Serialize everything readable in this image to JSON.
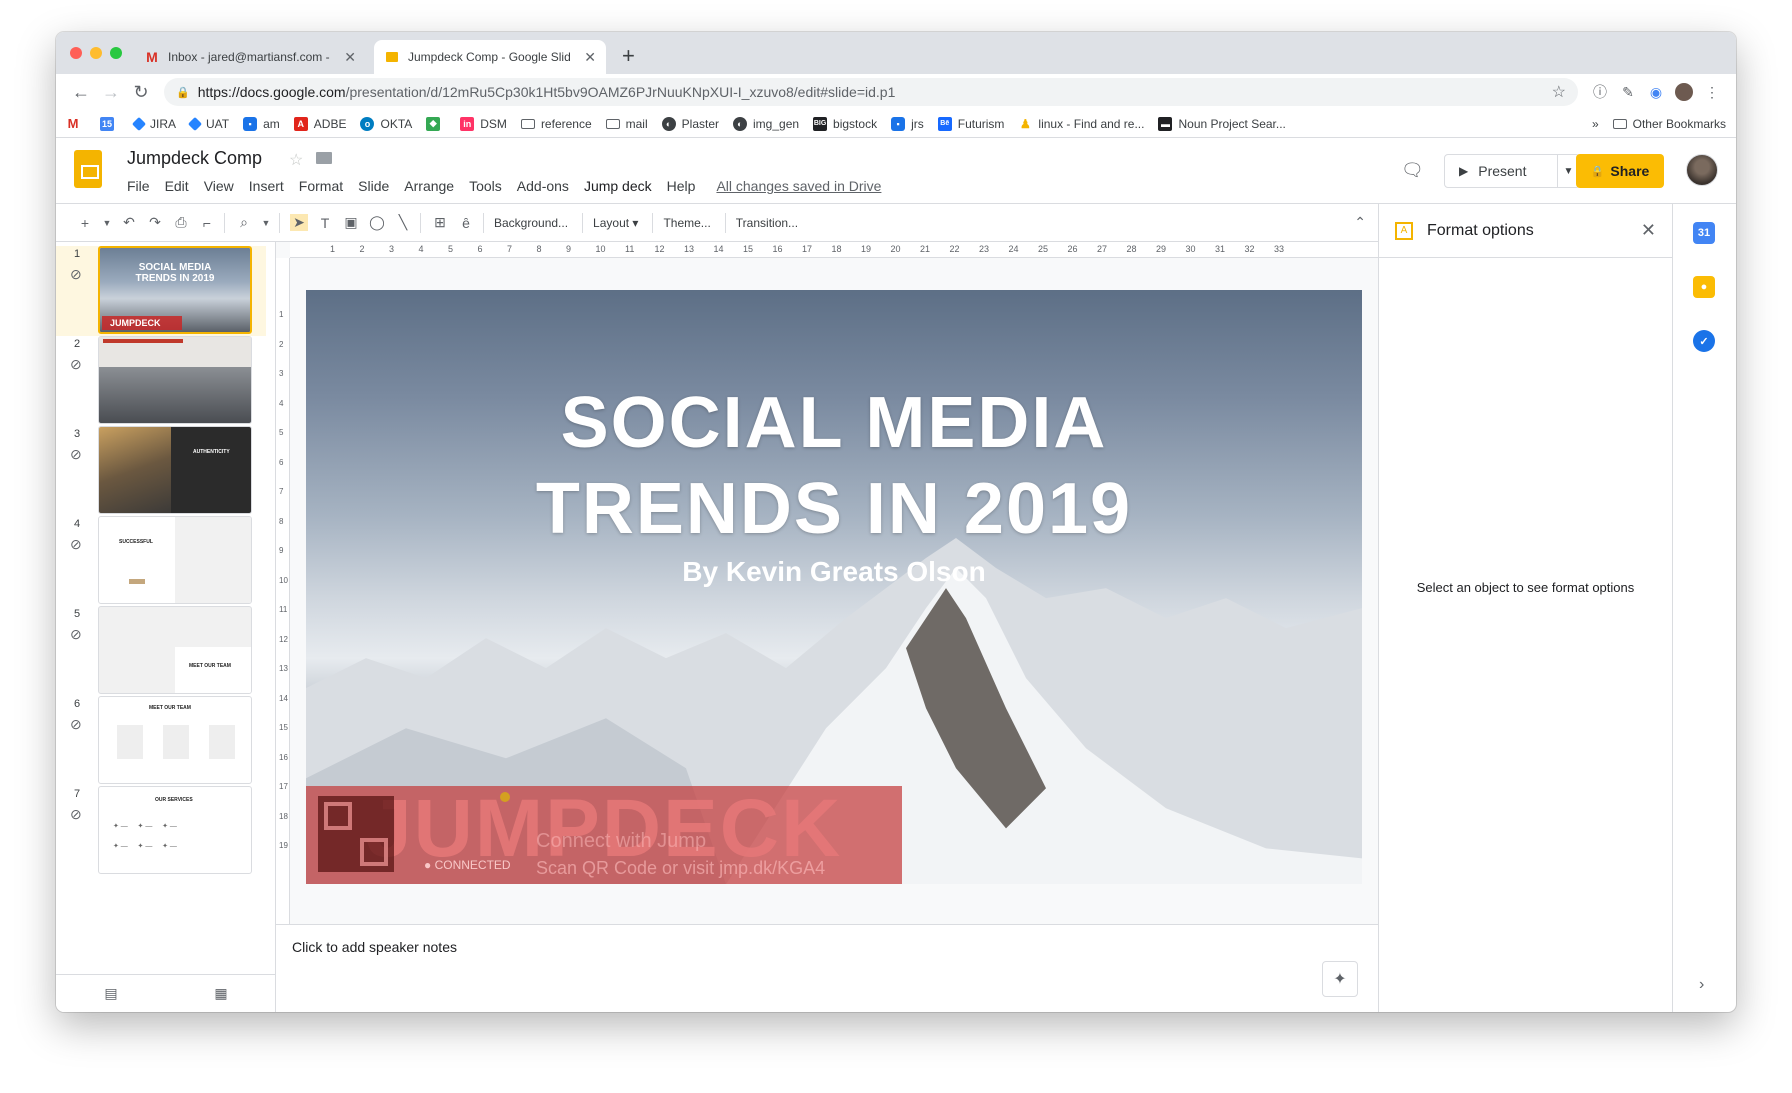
{
  "browser": {
    "tabs": [
      {
        "title": "Inbox - jared@martiansf.com -",
        "favicon": "gmail-icon",
        "active": false
      },
      {
        "title": "Jumpdeck Comp - Google Slid",
        "favicon": "slides-icon",
        "active": true
      }
    ],
    "new_tab": "+",
    "url_host": "https://docs.google.com",
    "url_path": "/presentation/d/12mRu5Cp30k1Ht5bv9OAMZ6PJrNuuKNpXUI-I_xzuvo8/edit#slide=id.p1",
    "bookmarks": [
      {
        "label": "",
        "icon": "gmail-icon",
        "color": "#d93025"
      },
      {
        "label": "",
        "icon": "calendar-icon",
        "color": "#4285f4"
      },
      {
        "label": "JIRA",
        "icon": "jira-icon",
        "color": "#2684ff"
      },
      {
        "label": "UAT",
        "icon": "jira-icon",
        "color": "#2684ff"
      },
      {
        "label": "am",
        "icon": "chat-icon",
        "color": "#1a73e8"
      },
      {
        "label": "ADBE",
        "icon": "adobe-icon",
        "color": "#e1251b"
      },
      {
        "label": "OKTA",
        "icon": "okta-icon",
        "color": "#007dc1"
      },
      {
        "label": "",
        "icon": "maps-icon",
        "color": "#34a853"
      },
      {
        "label": "DSM",
        "icon": "invision-icon",
        "color": "#ff3366"
      },
      {
        "label": "reference",
        "icon": "folder-icon",
        "color": "#5f6368"
      },
      {
        "label": "mail",
        "icon": "folder-icon",
        "color": "#5f6368"
      },
      {
        "label": "Plaster",
        "icon": "globe-icon",
        "color": "#3c4043"
      },
      {
        "label": "img_gen",
        "icon": "globe-icon",
        "color": "#3c4043"
      },
      {
        "label": "bigstock",
        "icon": "bigstock-icon",
        "color": "#202124"
      },
      {
        "label": "jrs",
        "icon": "chat-icon",
        "color": "#1a73e8"
      },
      {
        "label": "Futurism",
        "icon": "behance-icon",
        "color": "#1769ff"
      },
      {
        "label": "linux - Find and re...",
        "icon": "linux-icon",
        "color": "#f4b400"
      },
      {
        "label": "Noun Project Sear...",
        "icon": "noun-project-icon",
        "color": "#202124"
      }
    ],
    "bookmarks_overflow": "»",
    "other_bookmarks": "Other Bookmarks"
  },
  "docs": {
    "title": "Jumpdeck Comp",
    "menu": [
      "File",
      "Edit",
      "View",
      "Insert",
      "Format",
      "Slide",
      "Arrange",
      "Tools",
      "Add-ons",
      "Jump deck",
      "Help"
    ],
    "saved_status": "All changes saved in Drive",
    "present_label": "Present",
    "share_label": "Share"
  },
  "toolbar": {
    "background": "Background...",
    "layout": "Layout",
    "theme": "Theme...",
    "transition": "Transition..."
  },
  "filmstrip": {
    "slides": [
      {
        "num": "1",
        "title": "SOCIAL MEDIA TRENDS IN 2019",
        "badge": "JUMPDECK"
      },
      {
        "num": "2"
      },
      {
        "num": "3",
        "title": "AUTHENTICITY"
      },
      {
        "num": "4",
        "title": "SUCCESSFUL"
      },
      {
        "num": "5",
        "title": "MEET OUR TEAM"
      },
      {
        "num": "6",
        "title": "MEET OUR TEAM"
      },
      {
        "num": "7",
        "title": "OUR SERVICES"
      }
    ]
  },
  "slide": {
    "title_line1": "SOCIAL MEDIA",
    "title_line2": "TRENDS IN 2019",
    "subtitle": "By Kevin Greats Olson",
    "badge_text": "JUMPDECK",
    "connected": "CONNECTED",
    "connect_text": "Connect with Jump",
    "scan_text": "Scan QR Code or visit jmp.dk/KGA4"
  },
  "notes": {
    "placeholder": "Click to add speaker notes"
  },
  "format_panel": {
    "title": "Format options",
    "hint": "Select an object to see format options"
  },
  "ruler": {
    "h_ticks": [
      "1",
      "2",
      "3",
      "4",
      "5",
      "6",
      "7",
      "8",
      "9",
      "10",
      "11",
      "12",
      "13",
      "14",
      "15",
      "16",
      "17",
      "18",
      "19",
      "20",
      "21",
      "22",
      "23",
      "24",
      "25",
      "26",
      "27",
      "28",
      "29",
      "30",
      "31",
      "32",
      "33"
    ],
    "v_ticks": [
      "1",
      "2",
      "3",
      "4",
      "5",
      "6",
      "7",
      "8",
      "9",
      "10",
      "11",
      "12",
      "13",
      "14",
      "15",
      "16",
      "17",
      "18",
      "19"
    ]
  }
}
